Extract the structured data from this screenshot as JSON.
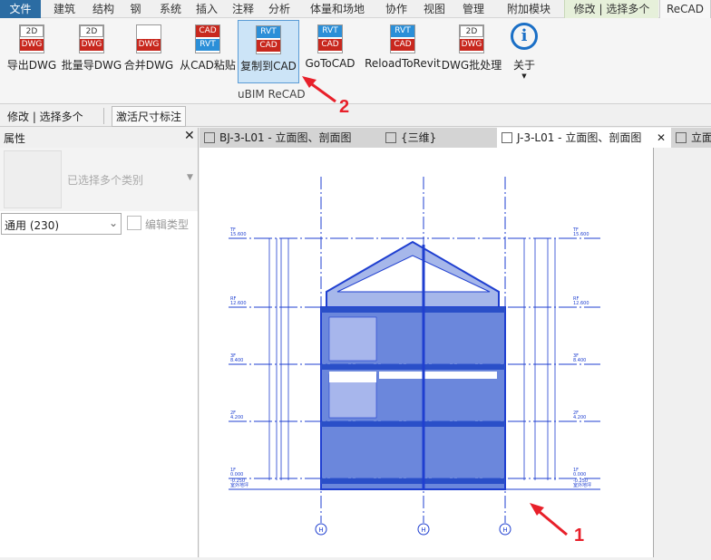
{
  "ribbon_tabs": [
    "文件",
    "建筑",
    "结构",
    "钢",
    "系统",
    "插入",
    "注释",
    "分析",
    "体量和场地",
    "协作",
    "视图",
    "管理",
    "附加模块",
    "修改 | 选择多个",
    "ReCAD"
  ],
  "ribbon_buttons": [
    {
      "label": "导出DWG",
      "icon": "export-dwg-icon"
    },
    {
      "label": "批量导DWG",
      "icon": "batch-export-dwg-icon"
    },
    {
      "label": "合并DWG",
      "icon": "merge-dwg-icon"
    },
    {
      "label": "从CAD粘贴",
      "icon": "paste-from-cad-icon"
    },
    {
      "label": "复制到CAD",
      "icon": "copy-to-cad-icon",
      "active": true
    },
    {
      "label": "GoToCAD",
      "icon": "go-to-cad-icon"
    },
    {
      "label": "ReloadToRevit",
      "icon": "reload-to-revit-icon"
    },
    {
      "label": "DWG批处理",
      "icon": "dwg-batch-icon"
    },
    {
      "label": "关于",
      "icon": "info-icon"
    }
  ],
  "icon_tags": {
    "d2": "2D",
    "dwg": "DWG",
    "cad": "CAD",
    "rvt": "RVT"
  },
  "panel_label": "uBIM ReCAD",
  "options_bar": {
    "context": "修改 | 选择多个",
    "activate_dims": "激活尺寸标注"
  },
  "properties": {
    "title": "属性",
    "type_label": "已选择多个类别",
    "filter": "通用 (230)",
    "edit_type": "编辑类型"
  },
  "view_tabs": [
    {
      "label": "BJ-3-L01 - 立面图、剖面图"
    },
    {
      "label": "{三维}"
    },
    {
      "label": "J-3-L01 - 立面图、剖面图",
      "active": true
    },
    {
      "label": "立面"
    }
  ],
  "drawing": {
    "levels": [
      {
        "name": "TF",
        "elev": "15.600"
      },
      {
        "name": "RF",
        "elev": "12.600"
      },
      {
        "name": "3F",
        "elev": "8.400"
      },
      {
        "name": "2F",
        "elev": "4.200"
      },
      {
        "name": "1F",
        "elev": "0.000"
      },
      {
        "name": "-0.250",
        "elev": "室外地坪"
      }
    ],
    "grids": [
      "H",
      "H",
      "H"
    ],
    "color": "#1f3fd0",
    "fill": "#3a5fd0"
  },
  "annotations": [
    {
      "label": "1",
      "color": "#e8202a"
    },
    {
      "label": "2",
      "color": "#e8202a"
    }
  ]
}
